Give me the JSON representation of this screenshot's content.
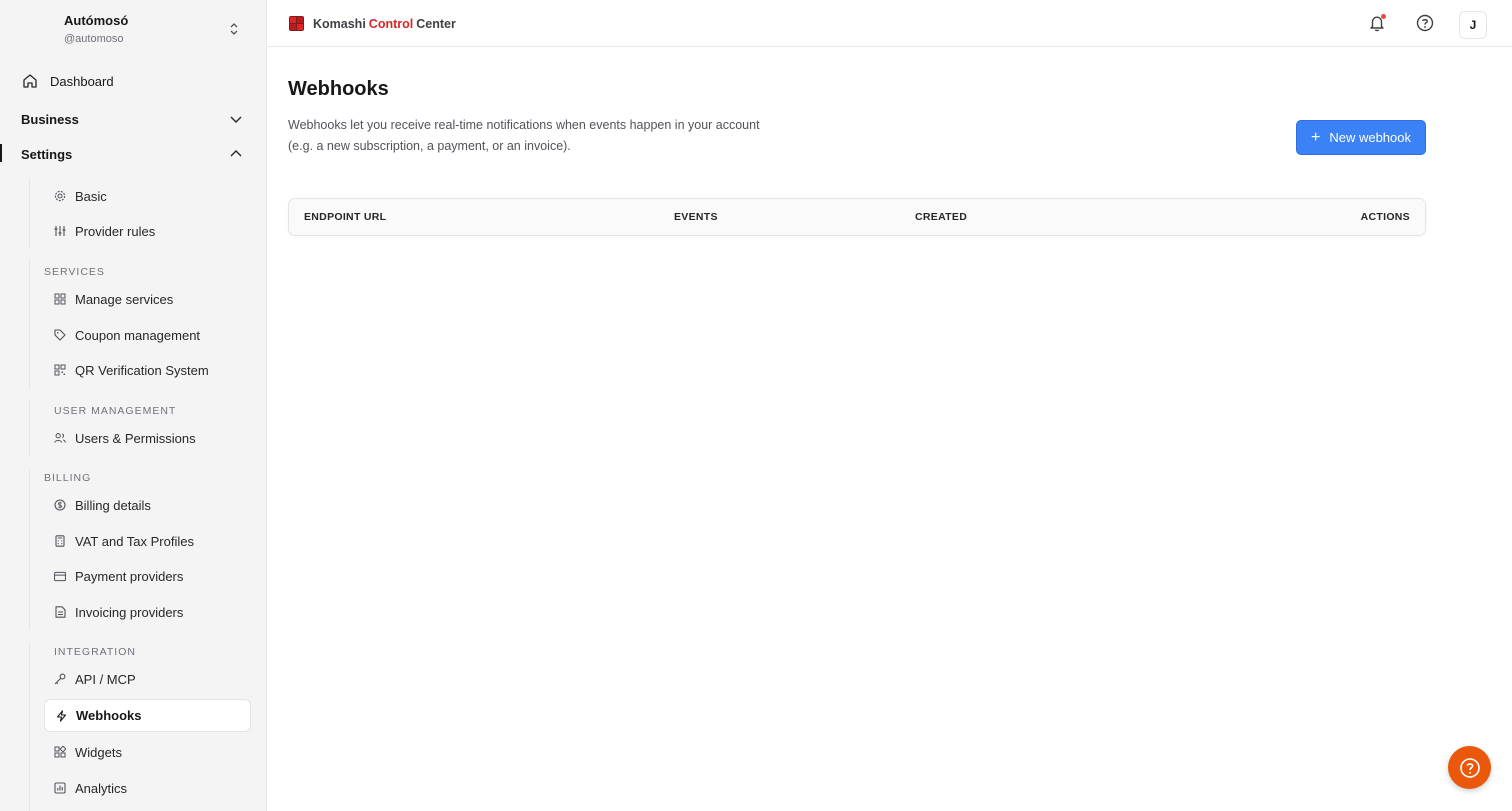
{
  "account": {
    "name": "Autómosó",
    "handle": "@automoso"
  },
  "nav": {
    "dashboard": "Dashboard",
    "business": "Business",
    "settings": "Settings",
    "settings_items": {
      "basic": "Basic",
      "provider_rules": "Provider rules"
    },
    "services": {
      "label": "SERVICES",
      "manage": "Manage services",
      "coupons": "Coupon management",
      "qr": "QR Verification System"
    },
    "user_management": {
      "label": "USER MANAGEMENT",
      "users": "Users & Permissions"
    },
    "billing": {
      "label": "BILLING",
      "details": "Billing details",
      "vat": "VAT and Tax Profiles",
      "payment": "Payment providers",
      "invoicing": "Invoicing providers"
    },
    "integration": {
      "label": "INTEGRATION",
      "api": "API / MCP",
      "webhooks": "Webhooks",
      "widgets": "Widgets",
      "analytics": "Analytics"
    }
  },
  "header": {
    "brand_part1": "Komashi",
    "brand_part2": "Control",
    "brand_part3": "Center",
    "avatar_initial": "J"
  },
  "page": {
    "title": "Webhooks",
    "description": "Webhooks let you receive real-time notifications when events happen in your account (e.g. a new subscription, a payment, or an invoice).",
    "new_button": "New webhook"
  },
  "table": {
    "columns": [
      "ENDPOINT URL",
      "EVENTS",
      "CREATED",
      "ACTIONS"
    ],
    "rows": []
  },
  "colors": {
    "primary": "#3b82f6",
    "brand_red": "#dc2626",
    "fab": "#ea580c"
  }
}
